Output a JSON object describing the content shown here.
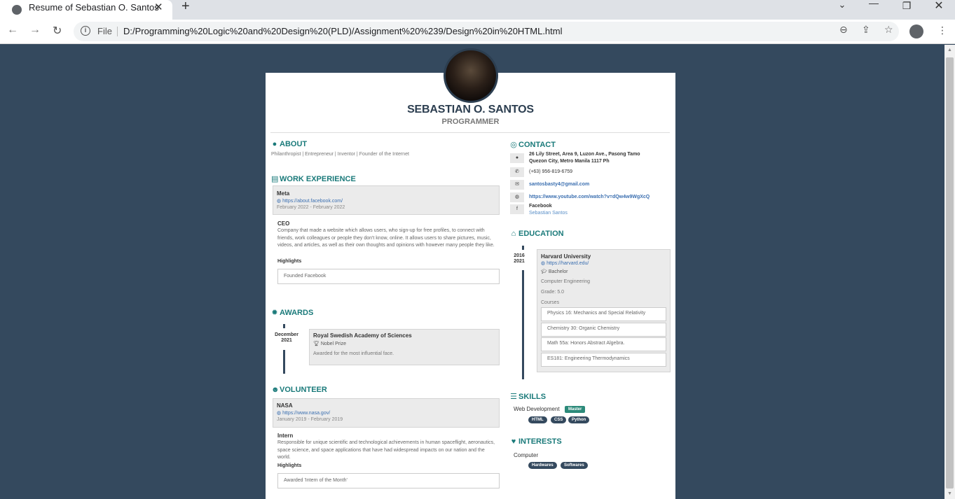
{
  "browser": {
    "tab_title": "Resume of Sebastian O. Santos",
    "address_prefix": "File",
    "url": "D:/Programming%20Logic%20and%20Design%20(PLD)/Assignment%20%239/Design%20in%20HTML.html"
  },
  "profile": {
    "name": "SEBASTIAN O. SANTOS",
    "title": "PROGRAMMER"
  },
  "about": {
    "heading": "ABOUT",
    "text": "Philanthropist | Entrepreneur | Inventor | Founder of the Internet"
  },
  "work": {
    "heading": "WORK EXPERIENCE",
    "company": "Meta",
    "url": "https://about.facebook.com/",
    "dates": "February 2022 - February 2022",
    "position": "CEO",
    "summary": "Company that made a website which allows users, who sign-up for free profiles, to connect with friends, work colleagues or people they don't know, online. It allows users to share pictures, music, videos, and articles, as well as their own thoughts and opinions with however many people they like.",
    "highlights_label": "Highlights",
    "highlight": "Founded Facebook"
  },
  "awards": {
    "heading": "AWARDS",
    "date_month": "December",
    "date_year": "2021",
    "awarder": "Royal Swedish Academy of Sciences",
    "title": "Nobel Prize",
    "summary": "Awarded for the most influential face."
  },
  "volunteer": {
    "heading": "VOLUNTEER",
    "org": "NASA",
    "url": "https://www.nasa.gov/",
    "dates": "January 2019 - February 2019",
    "position": "Intern",
    "summary": "Responsible for unique scientific and technological achievements in human spaceflight, aeronautics, space science, and space applications that have had widespread impacts on our nation and the world.",
    "highlights_label": "Highlights",
    "highlight": "Awarded 'Intern of the Month'"
  },
  "contact": {
    "heading": "CONTACT",
    "address_line1": "26 Lily Street, Area 9, Luzon Ave., Pasong Tamo",
    "address_line2": "Quezon City, Metro Manila 1117 Ph",
    "phone": "(+63) 956-819-6759",
    "email": "santosbasty4@gmail.com",
    "website": "https://www.youtube.com/watch?v=dQw4w9WgXcQ",
    "social_network": "Facebook",
    "social_user": "Sebastian Santos"
  },
  "education": {
    "heading": "EDUCATION",
    "start": "2016",
    "end": "2021",
    "institution": "Harvard University",
    "url": "https://harvard.edu/",
    "degree": "Bachelor",
    "area": "Computer Engineering",
    "grade": "Grade: 5.0",
    "courses_label": "Courses",
    "courses": [
      "Physics 16: Mechanics and Special Relativity",
      "Chemistry 30: Organic Chemistry",
      "Math 55a: Honors Abstract Algebra.",
      "ES181: Engineering Thermodynamics"
    ]
  },
  "skills": {
    "heading": "SKILLS",
    "name": "Web Development",
    "level": "Master",
    "keywords": [
      "HTML",
      "CSS",
      "Python"
    ]
  },
  "interests": {
    "heading": "INTERESTS",
    "name": "Computer",
    "keywords": [
      "Hardwares",
      "Softwares"
    ]
  },
  "colors": {
    "page_background": "#34495e",
    "accent": "#1a7a7a",
    "badge_dark": "#34495e",
    "badge_green": "#2c8a7a"
  },
  "icons": {
    "about": "user-icon",
    "work": "briefcase-icon",
    "awards": "certificate-icon",
    "volunteer": "users-icon",
    "contact": "target-icon",
    "education": "university-icon",
    "skills": "list-icon",
    "interests": "heart-icon"
  }
}
